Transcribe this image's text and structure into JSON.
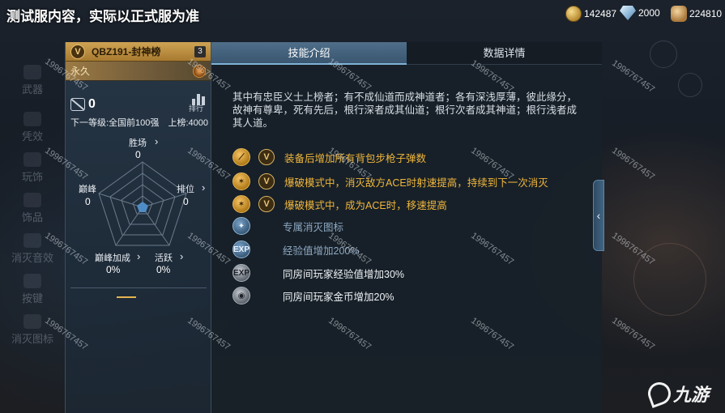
{
  "top_title": "测试服内容，实际以正式服为准",
  "currencies": [
    {
      "icon": "gold-coin-icon",
      "value": "142487"
    },
    {
      "icon": "diamond-icon",
      "value": "2000"
    },
    {
      "icon": "coin-stack-icon",
      "value": "224810"
    }
  ],
  "left_nav": [
    "武器",
    "凭效",
    "玩饰",
    "饰品",
    "消灭音效",
    "按键",
    "消灭图标"
  ],
  "card": {
    "badge": "V",
    "name": "QBZ191-封神榜",
    "count": "3",
    "duration": "永久",
    "kills": "0",
    "rank_icon_label": "排行",
    "next_level": "下一等级:全国前100强",
    "on_board": "上榜:4000"
  },
  "radar": {
    "axes": [
      {
        "label": "胜场",
        "value": "0"
      },
      {
        "label": "排位",
        "value": "0"
      },
      {
        "label": "活跃",
        "value": "0%"
      },
      {
        "label": "巅峰加成",
        "value": "0%"
      },
      {
        "label": "巅峰",
        "value": "0"
      }
    ]
  },
  "tabs": [
    {
      "label": "技能介绍",
      "active": true
    },
    {
      "label": "数据详情",
      "active": false
    }
  ],
  "description": "其中有忠臣义士上榜者；有不成仙道而成神道者；各有深浅厚薄，彼此缘分，故神有尊卑，死有先后，根行深者成其仙道；根行次者成其神道；根行浅者成其人道。",
  "skills": [
    {
      "icon": "bullet-gold-icon",
      "badge": "V",
      "text": "装备后增加所有背包步枪子弹数",
      "style": "gold"
    },
    {
      "icon": "burst-gold-icon",
      "badge": "V",
      "text": "爆破模式中，消灭敌方ACE时射速提高，持续到下一次消灭",
      "style": "gold"
    },
    {
      "icon": "burst-gold-icon",
      "badge": "V",
      "text": "爆破模式中，成为ACE时，移速提高",
      "style": "gold"
    },
    {
      "icon": "kill-icon-blue",
      "badge": "",
      "text": "专属消灭图标",
      "style": "blue"
    },
    {
      "icon": "exp-icon-blue",
      "badge": "",
      "text": "经验值增加200%",
      "style": "blue"
    },
    {
      "icon": "exp-icon-grey",
      "badge": "",
      "text": "同房间玩家经验值增加30%",
      "style": "white"
    },
    {
      "icon": "coin-icon-grey",
      "badge": "",
      "text": "同房间玩家金币增加20%",
      "style": "white"
    }
  ],
  "watermark": "1996767457",
  "logo_text": "九游",
  "colors": {
    "accent_gold": "#f0b63c",
    "tab_active": "#4f6e89",
    "panel_bg": "#182029"
  }
}
